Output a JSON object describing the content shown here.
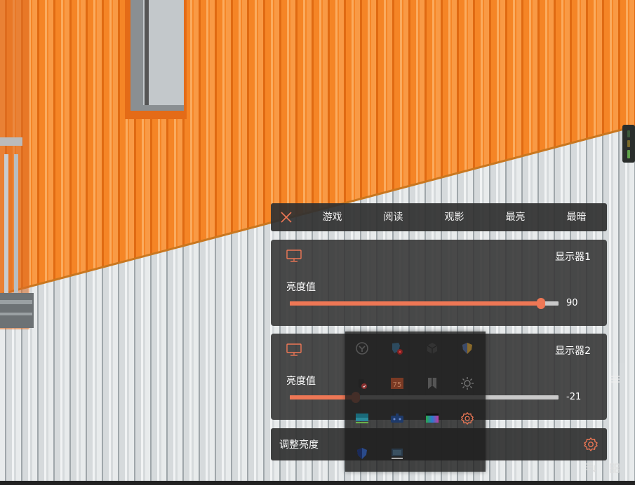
{
  "colors": {
    "accent": "#ee7755",
    "panel_bg": "#373737",
    "track": "#c9c9c9",
    "wall_orange": "#f58526",
    "wall_white": "#d8dcde"
  },
  "presets": {
    "close_icon": "close-icon",
    "items": [
      "游戏",
      "阅读",
      "观影",
      "最亮",
      "最暗"
    ]
  },
  "displays": [
    {
      "icon": "monitor-icon",
      "name": "显示器1",
      "brightness_label": "亮度值",
      "value": 90,
      "value_text": "90",
      "fraction": 0.935
    },
    {
      "icon": "monitor-icon",
      "name": "显示器2",
      "brightness_label": "亮度值",
      "value": -21,
      "value_text": "-21",
      "fraction": 0.245
    }
  ],
  "bottom": {
    "title": "调整亮度",
    "settings_icon": "gear-icon"
  },
  "tray_icons": [
    "app-logo-icon",
    "shield-x-icon",
    "cube-icon",
    "security-shield-icon",
    "usb-drive-icon",
    "calendar-75-icon",
    "bookmark-icon",
    "brightness-icon",
    "monitor-color-icon",
    "gamepad-icon",
    "monitor-rgb-icon",
    "gear-icon",
    "shield-blue-icon",
    "monitor-small-icon"
  ]
}
